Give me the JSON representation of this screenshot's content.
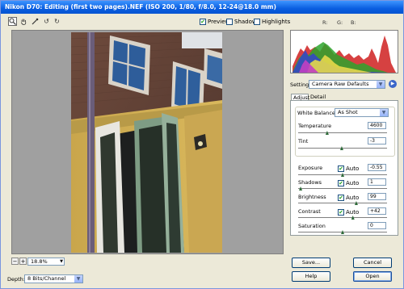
{
  "window": {
    "title": "Nikon D70:  Editing (first two pages).NEF  (ISO 200, 1/80, f/8.0, 12-24@18.0 mm)"
  },
  "toolbar": {
    "tools": [
      {
        "name": "zoom-tool-icon",
        "glyph": "🔍"
      },
      {
        "name": "hand-tool-icon",
        "glyph": "✋"
      },
      {
        "name": "eyedropper-tool-icon",
        "glyph": "✎"
      },
      {
        "name": "rotate-left-icon",
        "glyph": "↺"
      },
      {
        "name": "rotate-right-icon",
        "glyph": "↻"
      }
    ],
    "checkboxes": [
      {
        "label": "Preview",
        "checked": true
      },
      {
        "label": "Shadows",
        "checked": false
      },
      {
        "label": "Highlights",
        "checked": false
      }
    ],
    "rgb": {
      "r": "R:",
      "g": "G:",
      "b": "B:"
    }
  },
  "zoom": {
    "minus": "−",
    "plus": "+",
    "value": "18.8%"
  },
  "depth": {
    "label": "Depth:",
    "value": "8 Bits/Channel"
  },
  "settings": {
    "label": "Settings:",
    "value": "Camera Raw Defaults"
  },
  "tabs": [
    {
      "label": "Adjust"
    },
    {
      "label": "Detail"
    }
  ],
  "adjust": {
    "white_balance": {
      "label": "White Balance:",
      "value": "As Shot"
    },
    "temperature": {
      "label": "Temperature",
      "value": "4600",
      "level": 0.32
    },
    "tint": {
      "label": "Tint",
      "value": "-3",
      "level": 0.49
    },
    "exposure": {
      "label": "Exposure",
      "auto": "Auto",
      "value": "-0.55",
      "level": 0.5
    },
    "shadows": {
      "label": "Shadows",
      "auto": "Auto",
      "value": "1",
      "level": 0.01
    },
    "brightness": {
      "label": "Brightness",
      "auto": "Auto",
      "value": "99",
      "level": 0.66
    },
    "contrast": {
      "label": "Contrast",
      "auto": "Auto",
      "value": "+42",
      "level": 0.62
    },
    "saturation": {
      "label": "Saturation",
      "value": "0",
      "level": 0.5
    }
  },
  "buttons": {
    "save": "Save...",
    "cancel": "Cancel",
    "help": "Help",
    "open": "Open"
  },
  "colors": {
    "titlebar": "#0a5ee0",
    "checkmark": "#21a121"
  }
}
